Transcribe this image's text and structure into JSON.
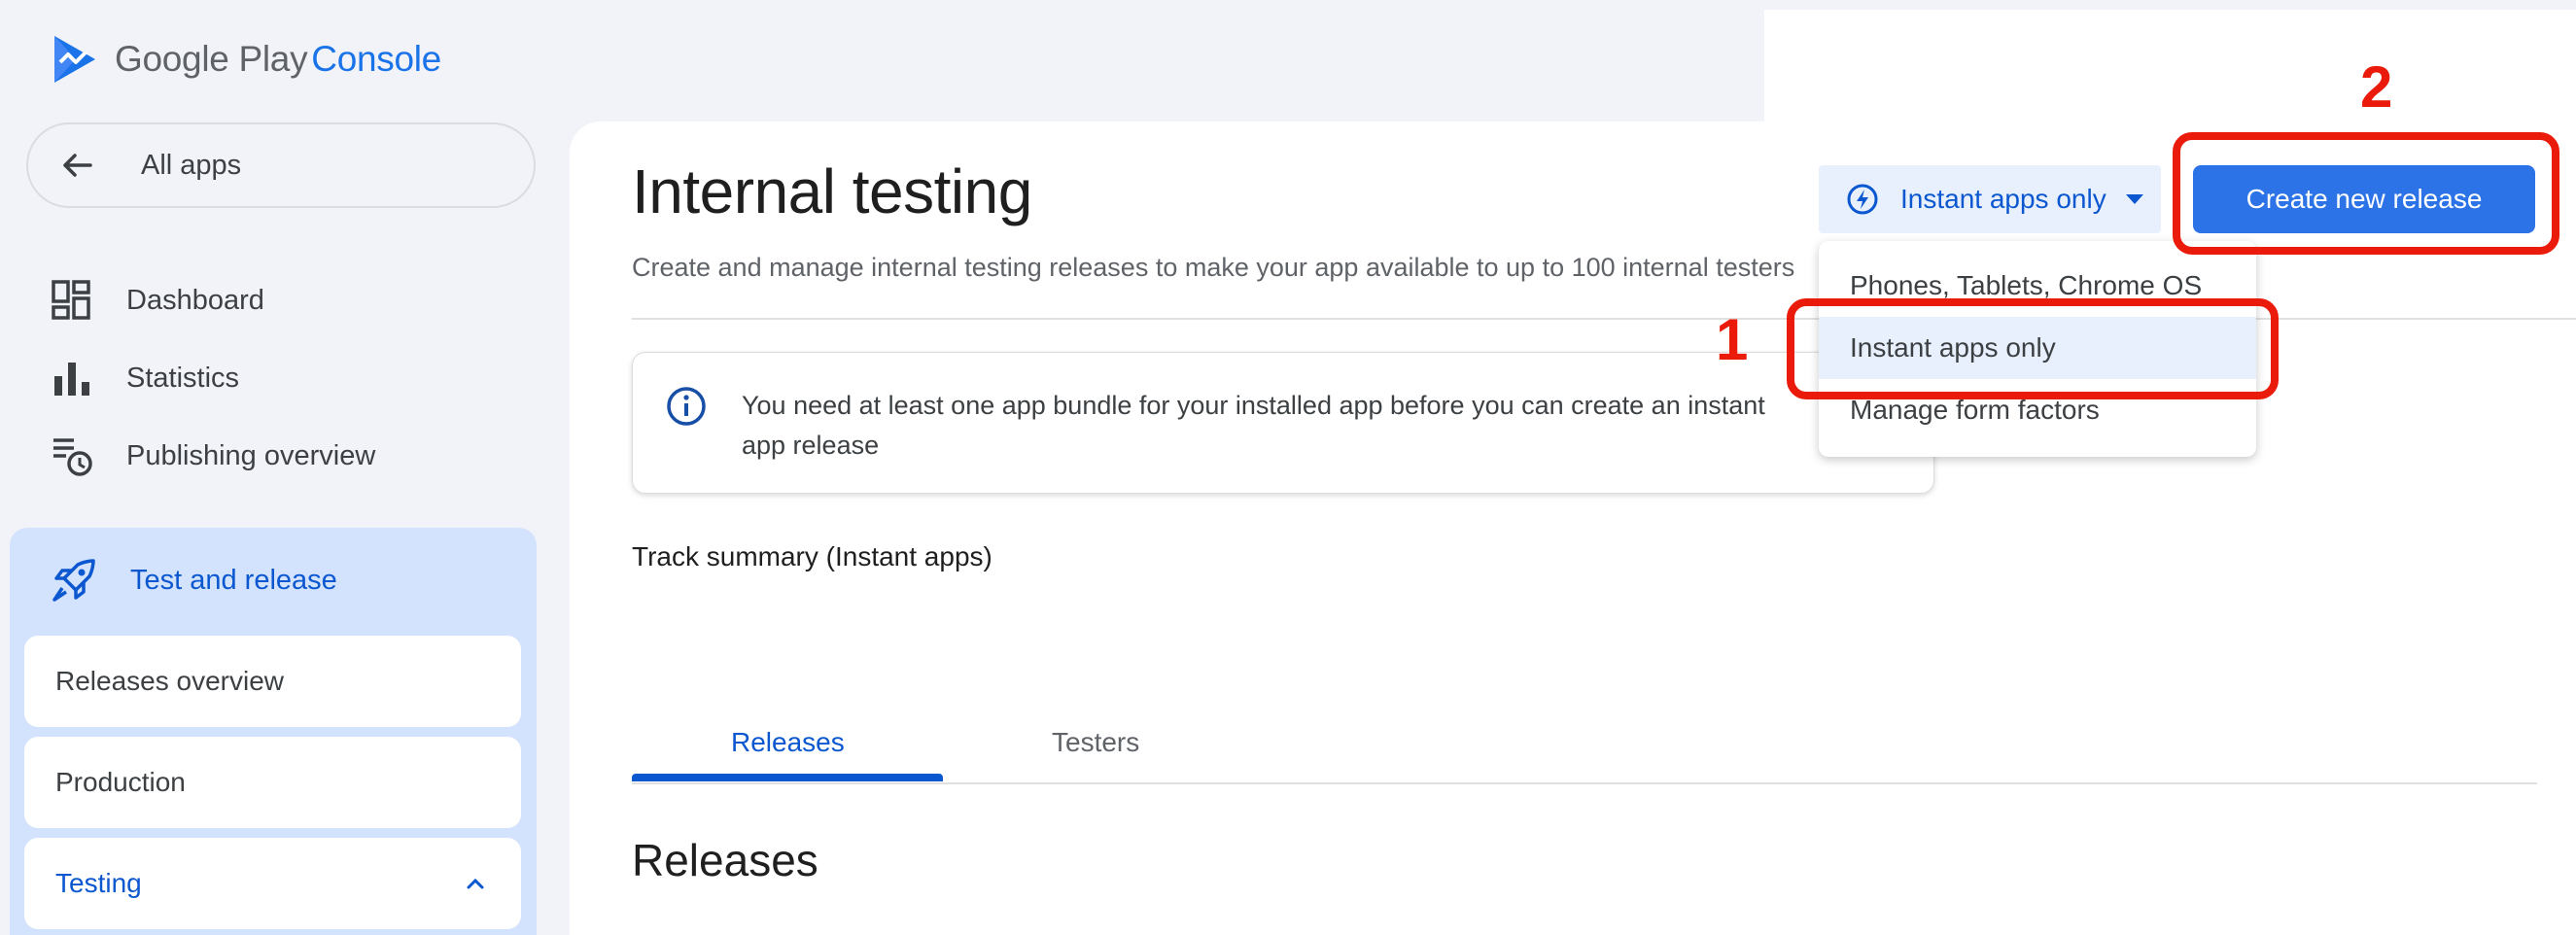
{
  "app": {
    "logo_text_1": "Google Play",
    "logo_text_2": "Console",
    "logo_icon": "google-play-console-icon"
  },
  "sidebar": {
    "all_apps_label": "All apps",
    "back_icon": "arrow-left-icon",
    "items": [
      {
        "label": "Dashboard",
        "icon": "dashboard-icon"
      },
      {
        "label": "Statistics",
        "icon": "bar-chart-icon"
      },
      {
        "label": "Publishing overview",
        "icon": "publishing-schedule-icon"
      }
    ],
    "test_and_release": {
      "label": "Test and release",
      "icon": "rocket-icon",
      "sub_items": [
        {
          "label": "Releases overview"
        },
        {
          "label": "Production"
        },
        {
          "label": "Testing",
          "expanded": true
        }
      ]
    }
  },
  "main": {
    "title": "Internal testing",
    "subtitle": "Create and manage internal testing releases to make your app available to up to 100 internal testers",
    "info_banner": {
      "icon": "info-icon",
      "text": "You need at least one app bundle for your installed app before you can create an instant app release"
    },
    "track_summary": "Track summary (Instant apps)",
    "tabs": [
      {
        "label": "Releases",
        "active": true
      },
      {
        "label": "Testers",
        "active": false
      }
    ],
    "section_title": "Releases"
  },
  "form_factor": {
    "selected_label": "Instant apps only",
    "icon": "bolt-icon",
    "options": [
      {
        "label": "Phones, Tablets, Chrome OS",
        "selected": false
      },
      {
        "label": "Instant apps only",
        "selected": true
      },
      {
        "label": "Manage form factors",
        "selected": false
      }
    ]
  },
  "actions": {
    "create_release_label": "Create new release"
  },
  "annotations": {
    "step_1": "1",
    "step_2": "2",
    "color": "#ea1b0b"
  },
  "colors": {
    "accent": "#0b57d0",
    "primary_button": "#2b73e6",
    "sidebar_active_bg": "#d3e3fd",
    "page_bg": "#f1f3f9"
  }
}
